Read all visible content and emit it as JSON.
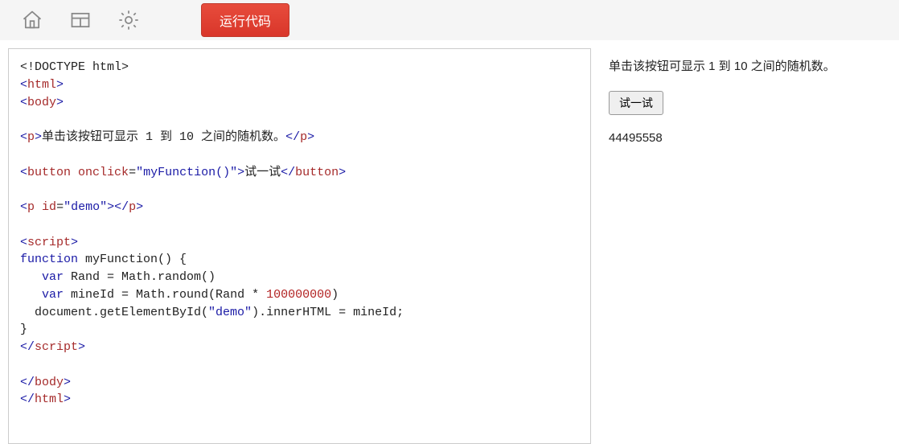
{
  "toolbar": {
    "run_label": "运行代码"
  },
  "code": {
    "l1_a": "<!DOCTYPE html>",
    "l2_open": "<",
    "l2_tag": "html",
    "l2_close": ">",
    "l3_open": "<",
    "l3_tag": "body",
    "l3_close": ">",
    "l5_open": "<",
    "l5_tag": "p",
    "l5_close": ">",
    "l5_text": "单击该按钮可显示 1 到 10 之间的随机数。",
    "l5_end_open": "</",
    "l5_end_tag": "p",
    "l5_end_close": ">",
    "l7_open": "<",
    "l7_tag": "button",
    "l7_sp": " ",
    "l7_attr": "onclick",
    "l7_eq": "=",
    "l7_val": "\"myFunction()\"",
    "l7_close": ">",
    "l7_text": "试一试",
    "l7_end_open": "</",
    "l7_end_tag": "button",
    "l7_end_close": ">",
    "l9_open": "<",
    "l9_tag": "p",
    "l9_sp": " ",
    "l9_attr": "id",
    "l9_eq": "=",
    "l9_val": "\"demo\"",
    "l9_close": ">",
    "l9_end_open": "</",
    "l9_end_tag": "p",
    "l9_end_close": ">",
    "l11_open": "<",
    "l11_tag": "script",
    "l11_close": ">",
    "l12_kwd": "function",
    "l12_rest": " myFunction() {",
    "l13_pre": "   ",
    "l13_kwd": "var",
    "l13_rest": " Rand = Math.random()",
    "l14_pre": "   ",
    "l14_kwd": "var",
    "l14_mid": " mineId = Math.round(Rand * ",
    "l14_num": "100000000",
    "l14_end": ")",
    "l15_pre": "  document.getElementById(",
    "l15_str": "\"demo\"",
    "l15_end": ").innerHTML = mineId;",
    "l16": "}",
    "l17_open": "</",
    "l17_tag": "script",
    "l17_close": ">",
    "l19_open": "</",
    "l19_tag": "body",
    "l19_close": ">",
    "l20_open": "</",
    "l20_tag": "html",
    "l20_close": ">"
  },
  "preview": {
    "description": "单击该按钮可显示 1 到 10 之间的随机数。",
    "button_label": "试一试",
    "output": "44495558"
  }
}
